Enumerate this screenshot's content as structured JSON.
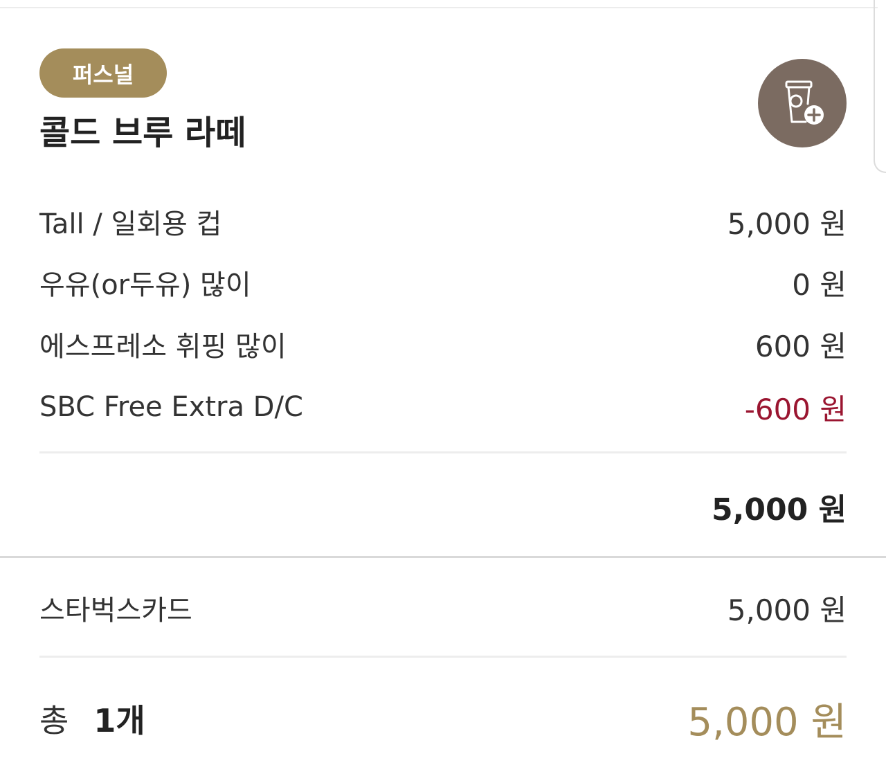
{
  "header": {
    "badge": "퍼스널",
    "title": "콜드 브루 라떼",
    "add_cup_icon": "cup-plus-icon"
  },
  "options": [
    {
      "label": "Tall / 일회용 컵",
      "price": "5,000 원"
    },
    {
      "label": "우유(or두유) 많이",
      "price": "0 원"
    },
    {
      "label": "에스프레소 휘핑 많이",
      "price": "600 원"
    },
    {
      "label": "SBC Free Extra D/C",
      "price": "-600 원"
    }
  ],
  "subtotal": "5,000 원",
  "payment": {
    "method": "스타벅스카드",
    "amount": "5,000 원"
  },
  "total": {
    "label": "총",
    "count": "1개",
    "price": "5,000 원"
  },
  "colors": {
    "accent": "#a48d5b",
    "discount": "#9a1530",
    "icon_bg": "#7b6b61"
  }
}
